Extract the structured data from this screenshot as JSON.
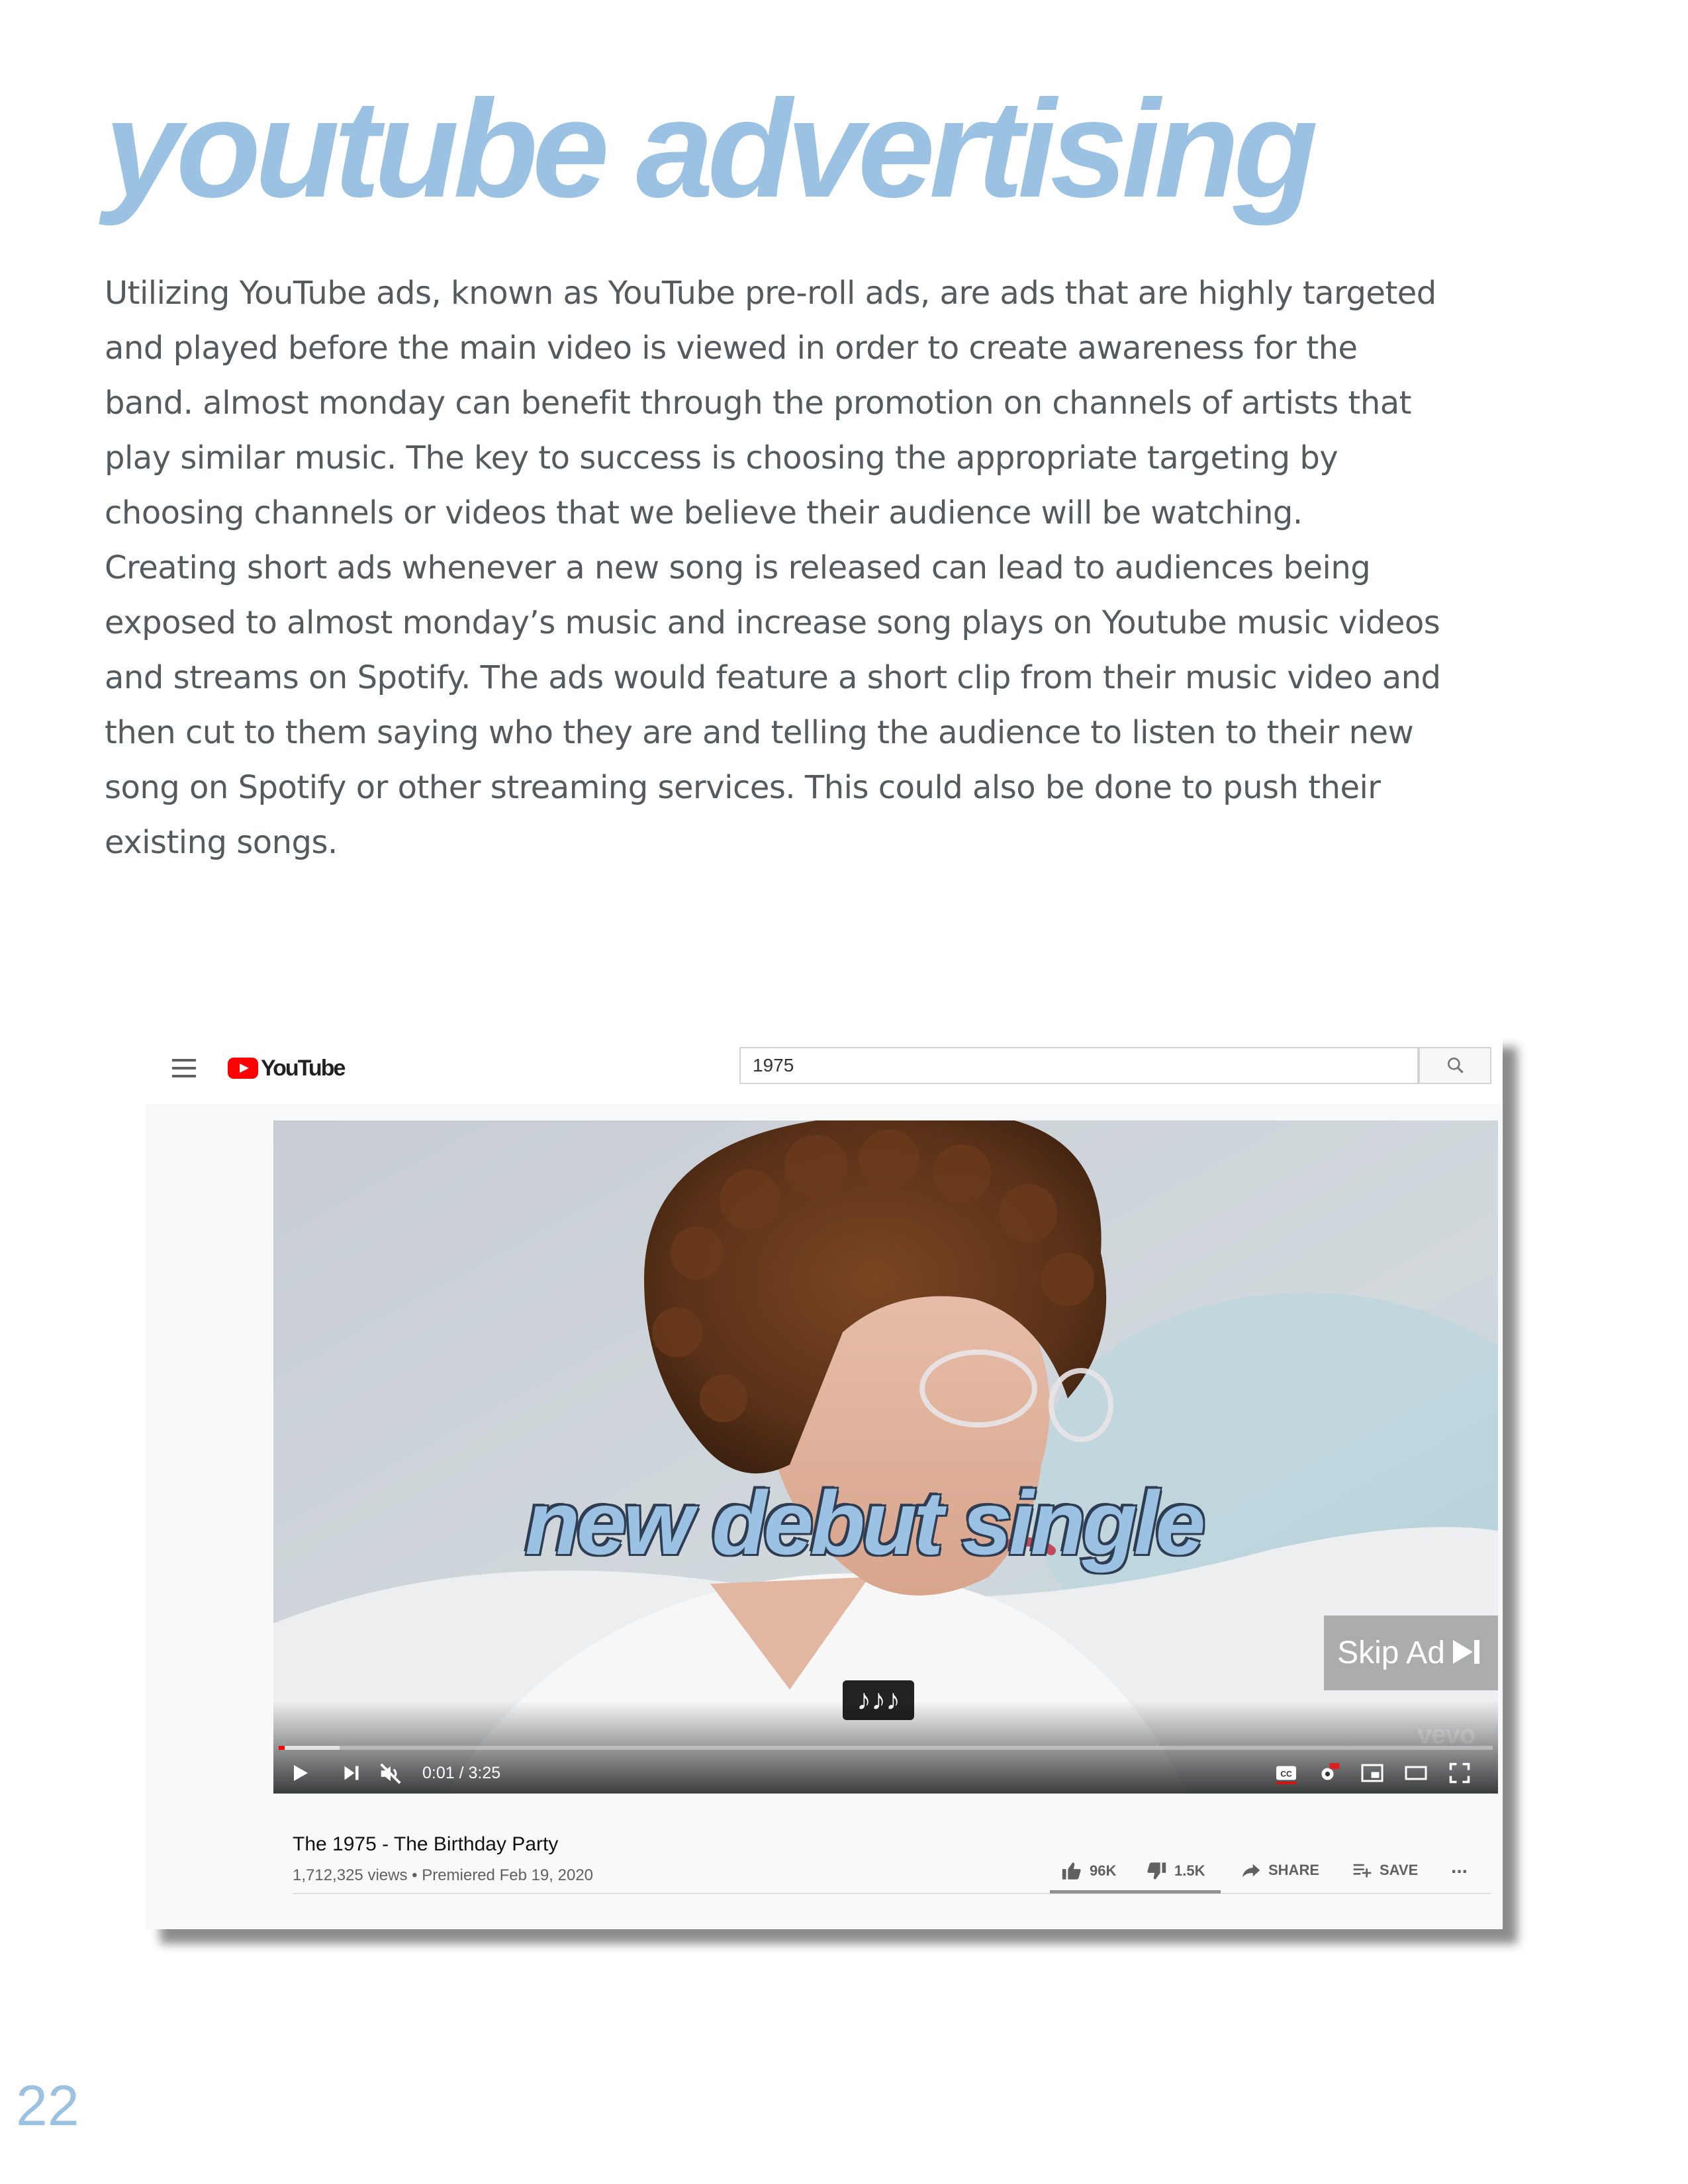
{
  "page": {
    "title": "youtube advertising",
    "body": "Utilizing YouTube ads, known as YouTube pre-roll ads, are ads that are highly targeted and played before the main video is viewed in order to create awareness for the band. almost monday can benefit through the promotion on channels of artists that play similar music. The key to success is choosing the appropriate targeting by choosing channels or videos that we believe their audience will be watching. Creating short ads whenever a new song is released can lead to audiences being exposed to almost monday’s music and increase song plays on Youtube music videos and streams on Spotify. The ads would feature a short clip from their music video and then cut to them saying who they are and telling the audience to listen to their new song on Spotify or other streaming services. This could also be done to push their existing songs.",
    "page_number": "22",
    "accent_color": "#9cc2e3",
    "text_color": "#555a5e"
  },
  "youtube": {
    "logo_text": "YouTube",
    "search_value": "1975",
    "player": {
      "overlay_text": "new debut single",
      "skip_label": "Skip Ad",
      "music_badge": "♪♪♪",
      "watermark": "vevo",
      "time": "0:01 / 3:25",
      "progress_played_fraction": 0.005,
      "progress_loaded_fraction": 0.05
    },
    "video": {
      "title": "The 1975 - The Birthday Party",
      "meta": "1,712,325 views • Premiered Feb 19, 2020",
      "likes": "96K",
      "dislikes": "1.5K",
      "share_label": "SHARE",
      "save_label": "SAVE",
      "more_label": "..."
    }
  }
}
